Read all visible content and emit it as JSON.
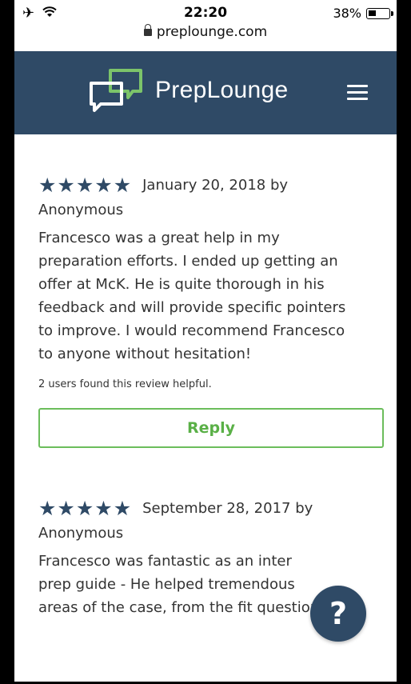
{
  "status_bar": {
    "time": "22:20",
    "battery": "38%",
    "battery_level": 0.38,
    "url": "preplounge.com"
  },
  "header": {
    "brand": "PrepLounge",
    "brand_color": "#2f4a66"
  },
  "reviews": [
    {
      "rating": 5,
      "meta": "January 20, 2018 by",
      "author": "Anonymous",
      "lines": [
        "Francesco was a great help in my",
        "preparation efforts. I ended up getting an",
        "offer at McK. He is quite thorough in his",
        "feedback and will provide specific pointers",
        "to improve. I would recommend Francesco",
        "to anyone without hesitation!"
      ],
      "helpful": "2 users found this review helpful.",
      "reply_label": "Reply"
    },
    {
      "rating": 5,
      "meta": "September 28, 2017 by",
      "author": "Anonymous",
      "lines": [
        "Francesco was fantastic as an inter",
        "prep guide - He helped tremendous",
        "areas of the case, from the fit questions, to"
      ]
    }
  ],
  "help_button": {
    "label": "?"
  },
  "colors": {
    "accent_green": "#6bbd5b",
    "star": "#2f4a66"
  }
}
